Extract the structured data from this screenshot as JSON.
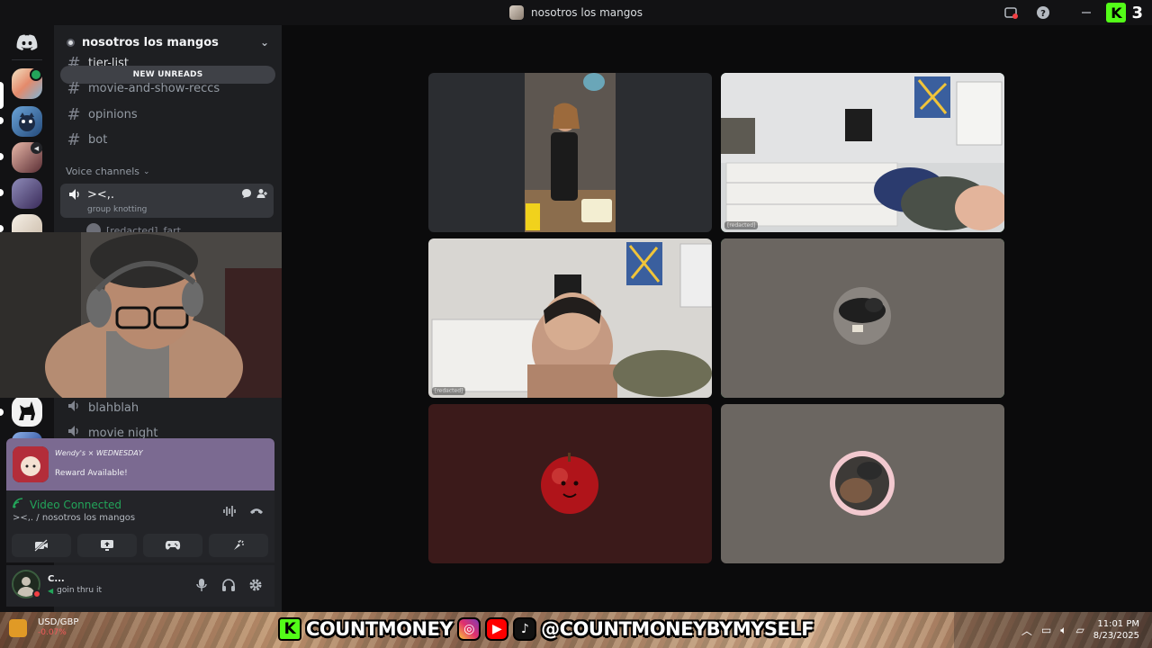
{
  "window": {
    "title": "nosotros los mangos",
    "kick_count": "3"
  },
  "guild": {
    "name": "nosotros los mangos"
  },
  "channels": {
    "new_unreads": "NEW UNREADS",
    "text": [
      {
        "label": "tier-list"
      },
      {
        "label": "movie-and-show-reccs"
      },
      {
        "label": "opinions"
      },
      {
        "label": "bot"
      }
    ],
    "voice_header": "Voice channels",
    "active_voice": {
      "name": "><,.",
      "status": "group knotting",
      "member": "[redacted]",
      "member_status": "fart"
    },
    "voice_more": [
      {
        "label": "blahblah"
      },
      {
        "label": "movie night"
      }
    ]
  },
  "promo_card": {
    "brand": "Wendy's × WEDNESDAY",
    "reward": "Reward Available!"
  },
  "rtc": {
    "status": "Video Connected",
    "location": "><,. / nosotros los mangos"
  },
  "user": {
    "name": "C...",
    "status": "goin thru it"
  },
  "tiles": [
    {
      "label": "",
      "speaking": false,
      "bg": "#2b2d31"
    },
    {
      "label": "[redacted]",
      "speaking": true,
      "bg": "#cfd2d4"
    },
    {
      "label": "[redacted]",
      "speaking": false,
      "bg": "#cfcac4"
    },
    {
      "label": "",
      "speaking": true,
      "bg": "#6b6661"
    },
    {
      "label": "",
      "speaking": false,
      "bg": "#3b1a1a"
    },
    {
      "label": "",
      "speaking": false,
      "bg": "#6b6661"
    }
  ],
  "streambar": {
    "ticker": "USD/GBP",
    "ticker_change": "-0.07%",
    "brand": "COUNTMONEY",
    "handle": "@COUNTMONEYBYMYSELF",
    "time": "11:01 PM",
    "date": "8/23/2025"
  },
  "colors": {
    "accent_green": "#23a55a",
    "kick_green": "#53fc18",
    "promo_purple": "#7b6a91"
  }
}
